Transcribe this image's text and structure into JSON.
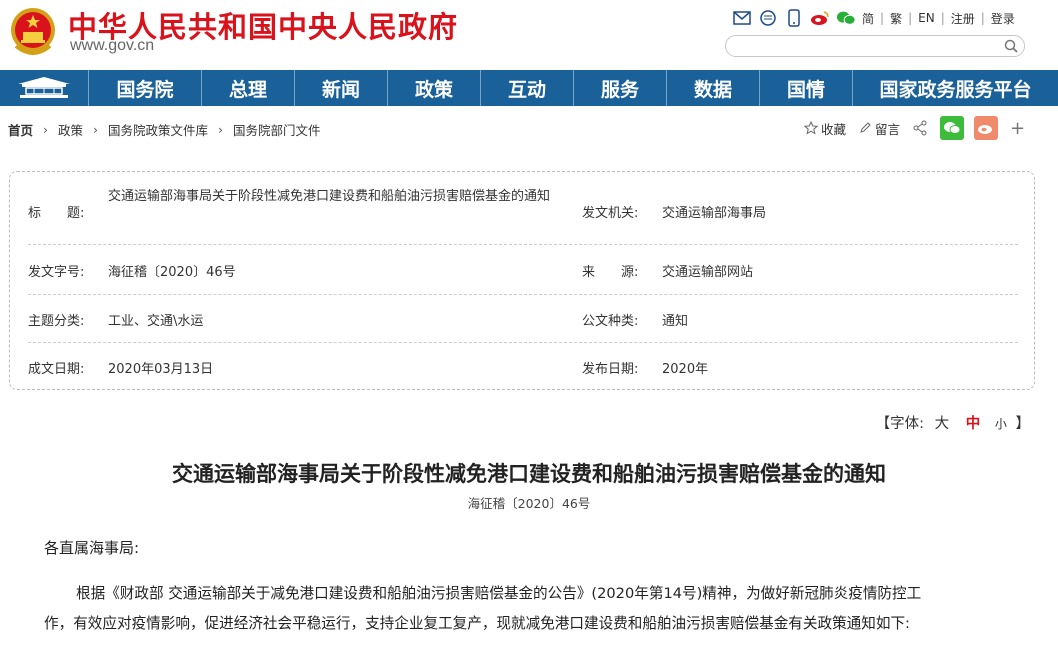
{
  "site": {
    "title": "中华人民共和国中央人民政府",
    "url": "www.gov.cn",
    "lang_links": [
      "简",
      "繁",
      "EN",
      "注册",
      "登录"
    ]
  },
  "colors": {
    "brand_red": "#d9121b",
    "nav_blue": "#1a6099"
  },
  "nav": {
    "items": [
      "国务院",
      "总理",
      "新闻",
      "政策",
      "互动",
      "服务",
      "数据",
      "国情",
      "国家政务服务平台"
    ]
  },
  "breadcrumb": [
    "首页",
    "政策",
    "国务院政策文件库",
    "国务院部门文件"
  ],
  "tools": {
    "favorite": "收藏",
    "comment": "留言"
  },
  "info": {
    "title_label": "标　　题:",
    "title_value": "交通运输部海事局关于阶段性减免港口建设费和船舶油污损害赔偿基金的通知",
    "issuer_label": "发文机关:",
    "issuer_value": "交通运输部海事局",
    "docno_label": "发文字号:",
    "docno_value": "海征稽〔2020〕46号",
    "source_label": "来　　源:",
    "source_value": "交通运输部网站",
    "topic_label": "主题分类:",
    "topic_value": "工业、交通\\水运",
    "type_label": "公文种类:",
    "type_value": "通知",
    "date_label": "成文日期:",
    "date_value": "2020年03月13日",
    "pub_label": "发布日期:",
    "pub_value": "2020年"
  },
  "fontsize": {
    "prefix": "【字体:",
    "large": "大",
    "medium": "中",
    "small": "小",
    "suffix": "】"
  },
  "article": {
    "title": "交通运输部海事局关于阶段性减免港口建设费和船舶油污损害赔偿基金的通知",
    "docno": "海征稽〔2020〕46号",
    "salutation": "各直属海事局:",
    "para1_line1": "根据《财政部 交通运输部关于减免港口建设费和船舶油污损害赔偿基金的公告》(2020年第14号)精神，为做好新冠肺炎疫情防控工",
    "para1_line2": "作，有效应对疫情影响，促进经济社会平稳运行，支持企业复工复产，现就减免港口建设费和船舶油污损害赔偿基金有关政策通知如下:"
  }
}
